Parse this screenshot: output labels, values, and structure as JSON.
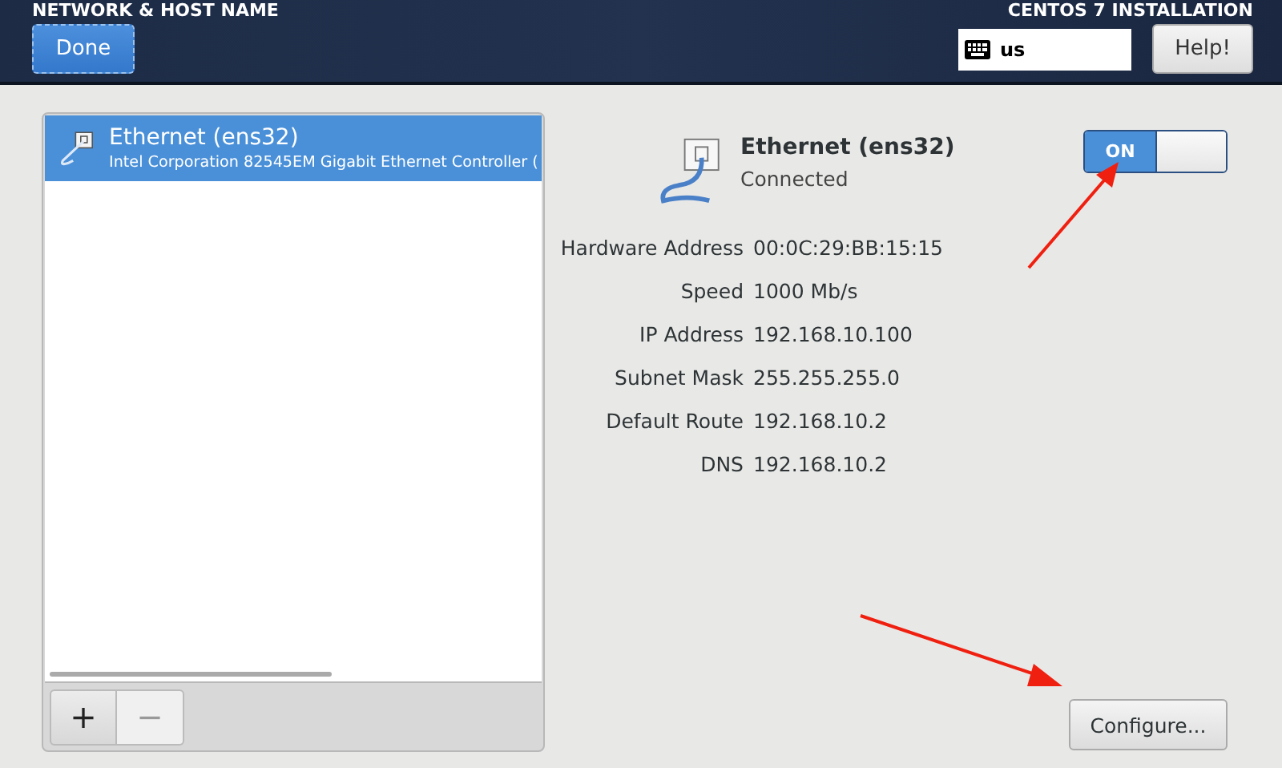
{
  "header": {
    "title": "NETWORK & HOST NAME",
    "done_button": "Done",
    "product": "CENTOS 7 INSTALLATION",
    "keyboard_layout": "us",
    "help_button": "Help!"
  },
  "devices": [
    {
      "name": "Ethernet (ens32)",
      "description": "Intel Corporation 82545EM Gigabit Ethernet Controller (",
      "selected": true
    }
  ],
  "list_buttons": [
    "+",
    "−"
  ],
  "device_detail": {
    "name": "Ethernet (ens32)",
    "status": "Connected",
    "toggle": {
      "label": "ON",
      "on": true
    },
    "properties": [
      {
        "label": "Hardware Address",
        "value": "00:0C:29:BB:15:15"
      },
      {
        "label": "Speed",
        "value": "1000 Mb/s"
      },
      {
        "label": "IP Address",
        "value": "192.168.10.100"
      },
      {
        "label": "Subnet Mask",
        "value": "255.255.255.0"
      },
      {
        "label": "Default Route",
        "value": "192.168.10.2"
      },
      {
        "label": "DNS",
        "value": "192.168.10.2"
      }
    ],
    "configure_button": "Configure..."
  }
}
